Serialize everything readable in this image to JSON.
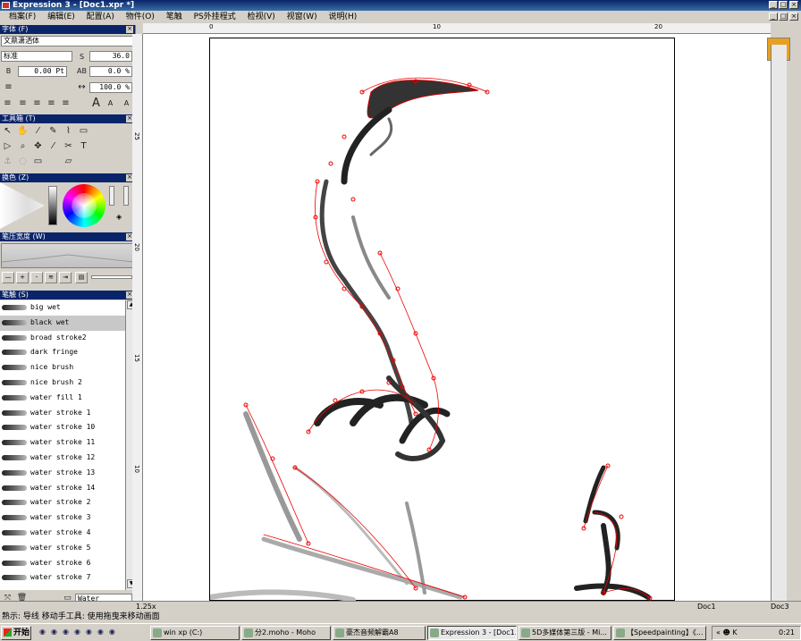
{
  "window": {
    "title": "Expression 3 - [Doc1.xpr *]"
  },
  "menu": [
    "档案(F)",
    "编辑(E)",
    "配置(A)",
    "物件(O)",
    "笔触",
    "PS外挂程式",
    "检视(V)",
    "视窗(W)",
    "说明(H)"
  ],
  "font_panel": {
    "title": "字体 (F)",
    "font_name": "文鼎潇洒体",
    "style": "标准",
    "size": "36.0",
    "baseline": "0.00 Pt",
    "tracking": "0.0 %",
    "scale": "100.0 %"
  },
  "toolbox": {
    "title": "工具箱 (T)"
  },
  "color_panel": {
    "title": "换色 (Z)"
  },
  "pressure_panel": {
    "title": "笔压宽度 (W)"
  },
  "brush_panel": {
    "title": "笔触 (S)",
    "items": [
      "big wet",
      "black wet",
      "broad stroke2",
      "dark fringe",
      "nice brush",
      "nice brush 2",
      "water fill 1",
      "water stroke 1",
      "water stroke 10",
      "water stroke 11",
      "water stroke 12",
      "water stroke 13",
      "water stroke 14",
      "water stroke 2",
      "water stroke 3",
      "water stroke 4",
      "water stroke 5",
      "water stroke 6",
      "water stroke 7"
    ],
    "selected": "black wet",
    "category": "Water"
  },
  "ruler": {
    "h_ticks": [
      "0",
      "10",
      "20"
    ],
    "v_ticks": [
      "25",
      "20",
      "15",
      "10"
    ]
  },
  "bottom": {
    "zoom": "1.25x",
    "doc_tab": "Doc1",
    "doc_tab2": "Doc3"
  },
  "status": {
    "text": "熟示: 导线   移动手工具: 使用拖曳来移动画面"
  },
  "taskbar": {
    "start": "开始",
    "tasks": [
      "win xp (C:)",
      "分2.moho - Moho",
      "豪杰音频解霸A8",
      "Expression 3 - [Doc1...",
      "5D多媒体第三版 - Mi...",
      "【Speedpainting】《..."
    ],
    "clock": "0:21"
  }
}
